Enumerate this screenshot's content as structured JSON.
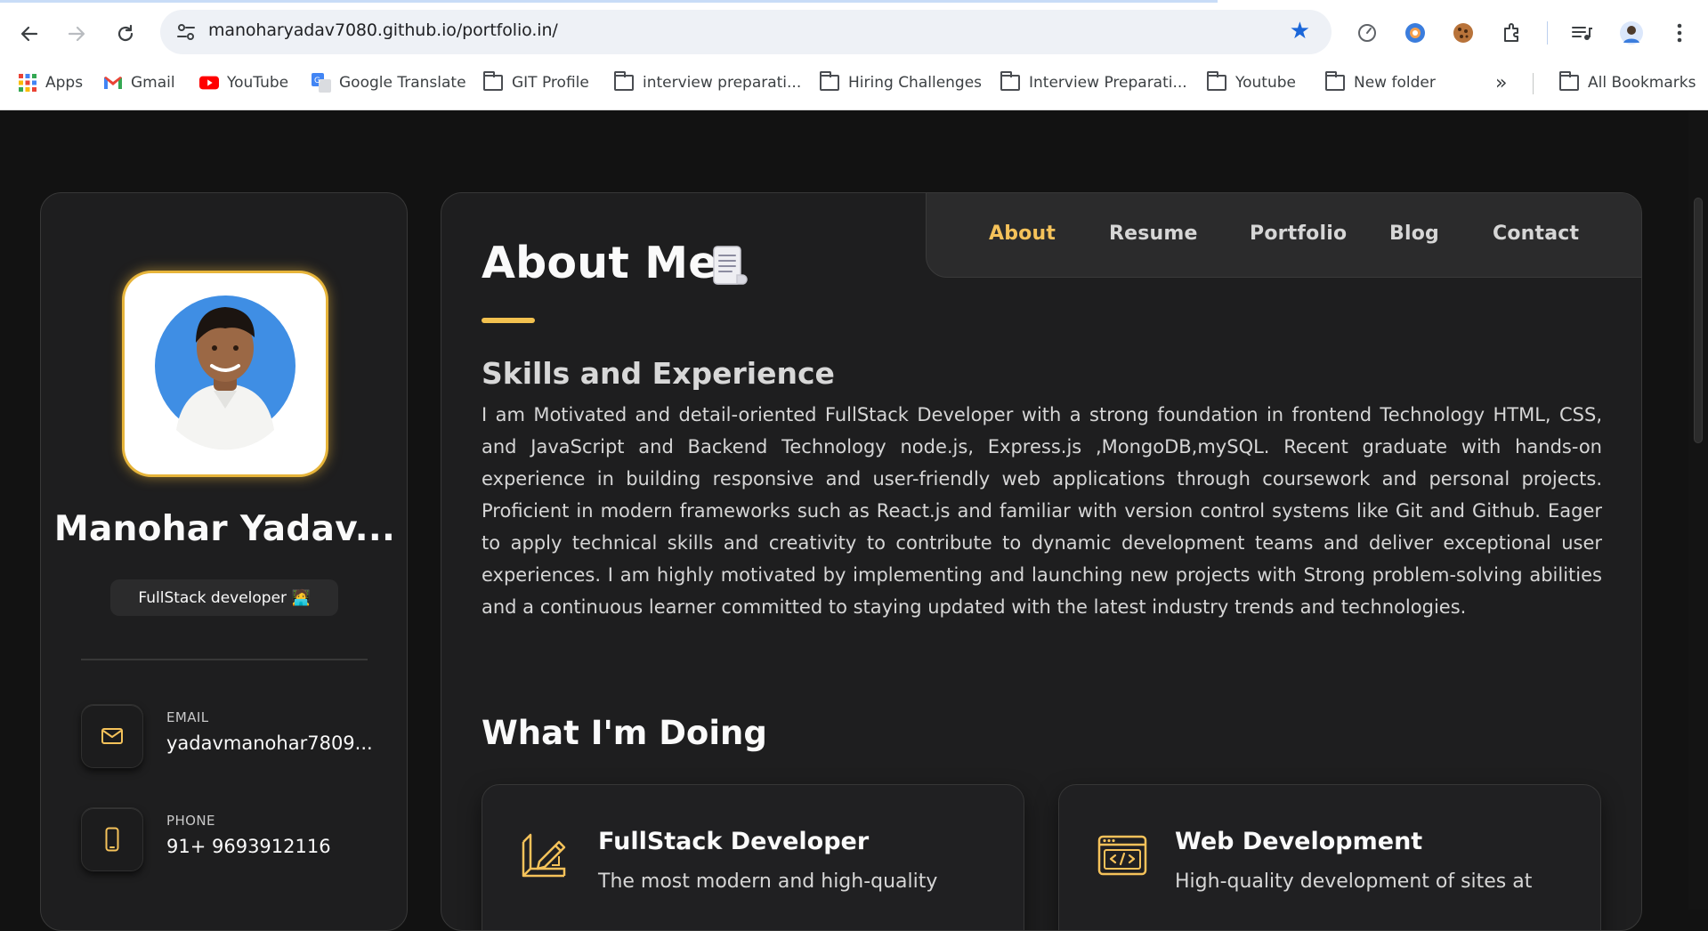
{
  "browser": {
    "url": "manoharyadav7080.github.io/portfolio.in/",
    "bookmarks": [
      {
        "label": "Apps",
        "icon": "apps-grid-icon"
      },
      {
        "label": "Gmail",
        "icon": "gmail-icon"
      },
      {
        "label": "YouTube",
        "icon": "youtube-icon"
      },
      {
        "label": "Google Translate",
        "icon": "google-translate-icon"
      },
      {
        "label": "GIT Profile",
        "icon": "folder-icon"
      },
      {
        "label": "interview preparati...",
        "icon": "folder-icon"
      },
      {
        "label": "Hiring Challenges",
        "icon": "folder-icon"
      },
      {
        "label": "Interview Preparati...",
        "icon": "folder-icon"
      },
      {
        "label": "Youtube",
        "icon": "folder-icon"
      },
      {
        "label": "New folder",
        "icon": "folder-icon"
      },
      {
        "label": "All Bookmarks",
        "icon": "folder-icon"
      }
    ],
    "overflow_label": "»"
  },
  "sidebar": {
    "name": "Manohar Yadav...",
    "title": "FullStack developer 🧑‍💻",
    "contacts": [
      {
        "label": "EMAIL",
        "value": "yadavmanohar7809...",
        "icon": "mail-icon"
      },
      {
        "label": "PHONE",
        "value": "91+ 9693912116",
        "icon": "phone-icon"
      }
    ]
  },
  "navbar": {
    "tabs": [
      "About",
      "Resume",
      "Portfolio",
      "Blog",
      "Contact"
    ],
    "active": "About"
  },
  "main": {
    "title": "About Me",
    "skills_heading": "Skills and Experience",
    "about_text": "I am Motivated and detail-oriented FullStack Developer with a strong foundation in frontend Technology HTML, CSS, and JavaScript and Backend Technology node.js, Express.js ,MongoDB,mySQL. Recent graduate with hands-on experience in building responsive and user-friendly web applications through coursework and personal projects. Proficient in modern frameworks such as React.js and familiar with version control systems like Git and Github. Eager to apply technical skills and creativity to contribute to dynamic development teams and deliver exceptional user experiences. I am highly motivated by implementing and launching new projects with Strong problem-solving abilities and a continuous learner committed to staying updated with the latest industry trends and technologies.",
    "doing_heading": "What I'm Doing",
    "services": [
      {
        "title": "FullStack Developer",
        "text": "The most modern and high-quality",
        "icon": "design-pencil-icon"
      },
      {
        "title": "Web Development",
        "text": "High-quality development of sites at",
        "icon": "code-window-icon"
      }
    ]
  },
  "colors": {
    "accent": "#f5c25a",
    "background": "#121212",
    "card": "#1e1e1f",
    "browser_star": "#1a66d9"
  }
}
